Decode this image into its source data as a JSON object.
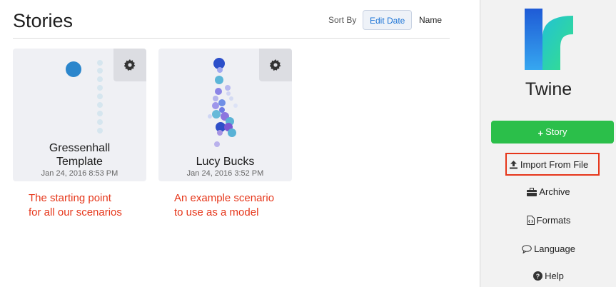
{
  "header": {
    "title": "Stories",
    "sort_label": "Sort By",
    "sort_edit_date": "Edit Date",
    "sort_name": "Name"
  },
  "stories": [
    {
      "name_line1": "Gressenhall",
      "name_line2": "Template",
      "date": "Jan 24, 2016 8:53 PM"
    },
    {
      "name_line1": "Lucy Bucks",
      "date": "Jan 24, 2016 3:52 PM"
    }
  ],
  "annotations": [
    {
      "line1": "The starting point",
      "line2": "for all our scenarios"
    },
    {
      "line1": "An example scenario",
      "line2": "to use as a model"
    }
  ],
  "sidebar": {
    "brand": "Twine",
    "new_story": "Story",
    "import": "Import From File",
    "archive": "Archive",
    "formats": "Formats",
    "language": "Language",
    "help": "Help"
  },
  "colors": {
    "accent": "#1a73d6",
    "green": "#2bbf4a",
    "annotation": "#e6361a"
  }
}
